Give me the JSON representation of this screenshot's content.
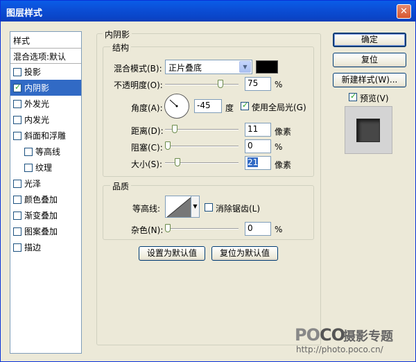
{
  "window": {
    "title": "图层样式",
    "close": "✕"
  },
  "style_list": {
    "header": "样式",
    "blend_options": "混合选项:默认",
    "items": [
      {
        "label": "投影",
        "checked": false
      },
      {
        "label": "内阴影",
        "checked": true,
        "selected": true
      },
      {
        "label": "外发光",
        "checked": false
      },
      {
        "label": "内发光",
        "checked": false
      },
      {
        "label": "斜面和浮雕",
        "checked": false
      },
      {
        "label": "等高线",
        "checked": false,
        "sub": true
      },
      {
        "label": "纹理",
        "checked": false,
        "sub": true
      },
      {
        "label": "光泽",
        "checked": false
      },
      {
        "label": "颜色叠加",
        "checked": false
      },
      {
        "label": "渐变叠加",
        "checked": false
      },
      {
        "label": "图案叠加",
        "checked": false
      },
      {
        "label": "描边",
        "checked": false
      }
    ]
  },
  "panel": {
    "title": "内阴影",
    "structure": {
      "title": "结构",
      "blend_mode_label": "混合模式(B):",
      "blend_mode_value": "正片叠底",
      "shadow_color": "#000000",
      "opacity_label": "不透明度(O):",
      "opacity_value": "75",
      "opacity_unit": "%",
      "angle_label": "角度(A):",
      "angle_value": "-45",
      "angle_unit": "度",
      "global_light_label": "使用全局光(G)",
      "global_light_checked": true,
      "distance_label": "距离(D):",
      "distance_value": "11",
      "distance_unit": "像素",
      "choke_label": "阻塞(C):",
      "choke_value": "0",
      "choke_unit": "%",
      "size_label": "大小(S):",
      "size_value": "21",
      "size_unit": "像素"
    },
    "quality": {
      "title": "品质",
      "contour_label": "等高线:",
      "anti_alias_label": "消除锯齿(L)",
      "anti_alias_checked": false,
      "noise_label": "杂色(N):",
      "noise_value": "0",
      "noise_unit": "%"
    },
    "make_default": "设置为默认值",
    "reset_default": "复位为默认值"
  },
  "buttons": {
    "ok": "确定",
    "reset": "复位",
    "new_style": "新建样式(W)...",
    "preview_label": "预览(V)",
    "preview_checked": true
  },
  "watermark": {
    "logo_a": "PO",
    "logo_b": "CO",
    "brand": "摄影专题",
    "url": "http://photo.poco.cn/"
  }
}
